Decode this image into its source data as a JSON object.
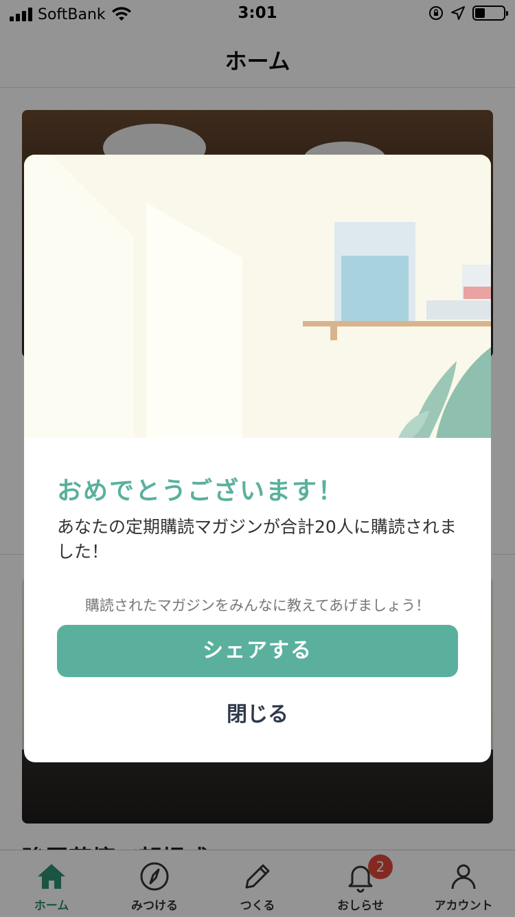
{
  "status_bar": {
    "carrier": "SoftBank",
    "time": "3:01"
  },
  "nav": {
    "title": "ホーム"
  },
  "feed": {
    "partial_title": "強羅花壇で朝掃式"
  },
  "modal": {
    "title": "おめでとうございます！",
    "message": "あなたの定期購読マガジンが合計20人に購読されました！",
    "hint": "購読されたマガジンをみんなに教えてあげましょう！",
    "share_label": "シェアする",
    "close_label": "閉じる"
  },
  "tabs": [
    {
      "label": "ホーム",
      "icon": "home-icon",
      "active": true
    },
    {
      "label": "みつける",
      "icon": "compass-icon",
      "active": false
    },
    {
      "label": "つくる",
      "icon": "pencil-icon",
      "active": false
    },
    {
      "label": "おしらせ",
      "icon": "bell-icon",
      "active": false,
      "badge": "2"
    },
    {
      "label": "アカウント",
      "icon": "person-icon",
      "active": false
    }
  ],
  "colors": {
    "accent": "#5ab09d",
    "active_tab": "#2f8f78",
    "badge": "#e0493b",
    "close_text": "#2e3a4a"
  }
}
